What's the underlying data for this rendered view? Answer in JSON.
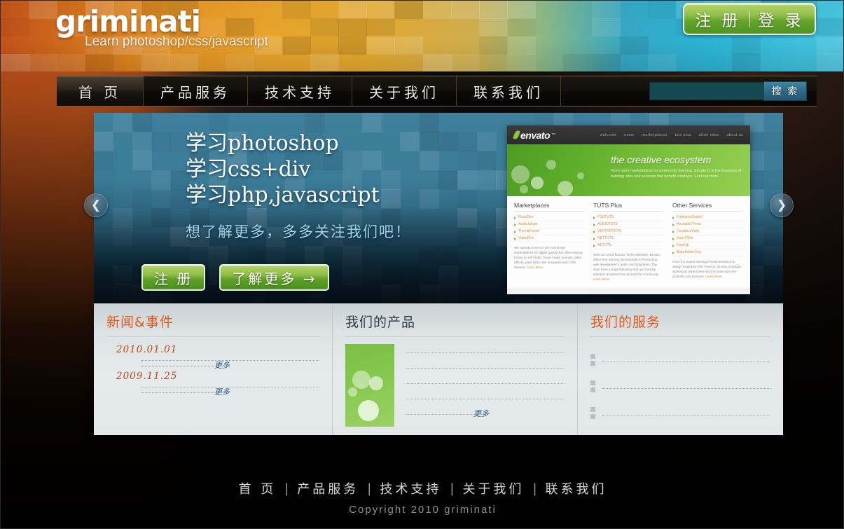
{
  "brand": {
    "name": "griminati",
    "tagline": "Learn photoshop/css/javascript"
  },
  "auth": {
    "register": "注 册",
    "login": "登 录"
  },
  "nav": {
    "items": [
      {
        "label": "首 页"
      },
      {
        "label": "产品服务"
      },
      {
        "label": "技术支持"
      },
      {
        "label": "关于我们"
      },
      {
        "label": "联系我们"
      }
    ],
    "search": {
      "value": "",
      "placeholder": "",
      "button": "搜 索"
    }
  },
  "hero": {
    "lines": [
      "学习photoshop",
      "学习css+div",
      "学习php,javascript"
    ],
    "subtitle": "想了解更多，多多关注我们吧！",
    "buttons": [
      {
        "label": "注 册"
      },
      {
        "label": "了解更多 →"
      }
    ],
    "prev_arrow": "❮",
    "next_arrow": "❯"
  },
  "envato": {
    "logo": "envato",
    "trademark": "™",
    "nav": [
      "welcome",
      "news",
      "marketplaces",
      "tuts plus",
      "other sites",
      "about us"
    ],
    "hero_title": "the creative ecosystem",
    "hero_desc": "From open marketplaces to community learning, Envato is in the business of building sites and services that benefit creatives. Find out more",
    "columns": [
      {
        "title": "Marketplaces",
        "links": [
          "FlashDen",
          "AudioJungle",
          "ThemeForest",
          "VideoHive"
        ],
        "blurb": "We operate a set of inter-connected marketplaces for digital goods that allow anyone to buy or sell Flash, music loops, sounds, video effects, pixel fonts, site templates and CMS themes.",
        "more": "Learn More"
      },
      {
        "title": "TUTS Plus",
        "links": [
          "PSDTUTS",
          "AUDIOTUTS",
          "VECTORTUTS",
          "NETTUTS",
          "AETUTS"
        ],
        "blurb": "With our world famous TUTS websites, Envato offers free training and tutorials in Photoshop, web development, audio and illustration. The sites have a huge following and our work by talented creatives from around the community.",
        "more": "Learn More"
      },
      {
        "title": "Other Services",
        "links": [
          "FreelanceSwitch",
          "Rockable Press",
          "Creattica Daily",
          "Jobs FSite",
          "FaveUp",
          "Blog Action Day"
        ],
        "blurb": "From the award winning FreelanceSwitch to design inspiration site FaveUp, Envato is always working to experiment and innovate with new products and services.",
        "more": "Learn More"
      }
    ]
  },
  "panel": {
    "news": {
      "title": "新闻&事件",
      "items": [
        {
          "date": "2010.01.01",
          "more": "更多"
        },
        {
          "date": "2009.11.25",
          "more": "更多"
        }
      ]
    },
    "products": {
      "title": "我们的产品",
      "more": "更多"
    },
    "services": {
      "title": "我们的服务",
      "items": [
        {},
        {},
        {}
      ]
    }
  },
  "footer": {
    "items": [
      "首 页",
      "产品服务",
      "技术支持",
      "关于我们",
      "联系我们"
    ],
    "separator": "|",
    "copyright": "Copyright 2010 griminati"
  },
  "colors": {
    "orange_accent": "#e35b1e",
    "green_button": "#63a32c",
    "hero_blue": "#3e7f9c",
    "news_date": "#c2481a",
    "link_blue": "#2f5f86",
    "envato_green": "#7ab648"
  }
}
